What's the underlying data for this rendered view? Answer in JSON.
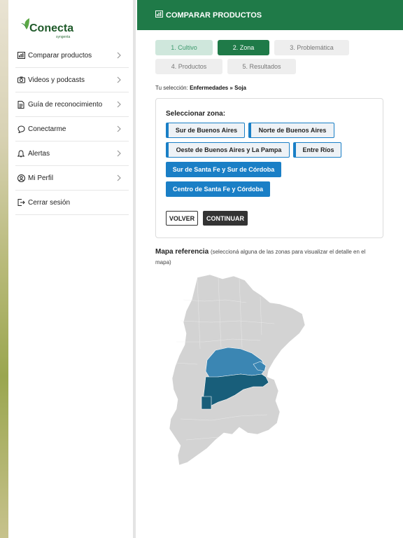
{
  "brand": {
    "name": "Conecta",
    "sub": "syngenta"
  },
  "sidebar": {
    "items": [
      {
        "label": "Comparar productos",
        "icon": "bar-chart-icon",
        "chevron": true
      },
      {
        "label": "Videos y podcasts",
        "icon": "camera-icon",
        "chevron": true
      },
      {
        "label": "Guía de reconocimiento",
        "icon": "document-icon",
        "chevron": true
      },
      {
        "label": "Conectarme",
        "icon": "chat-icon",
        "chevron": true
      },
      {
        "label": "Alertas",
        "icon": "bell-icon",
        "chevron": true
      },
      {
        "label": "Mi Perfil",
        "icon": "user-icon",
        "chevron": true
      },
      {
        "label": "Cerrar sesión",
        "icon": "logout-icon",
        "chevron": false
      }
    ]
  },
  "header": {
    "title": "COMPARAR PRODUCTOS",
    "icon": "bar-chart-icon"
  },
  "steps": [
    {
      "label": "1. Cultivo",
      "state": "done"
    },
    {
      "label": "2. Zona",
      "state": "active"
    },
    {
      "label": "3. Problemática",
      "state": "pending"
    },
    {
      "label": "4. Productos",
      "state": "pending"
    },
    {
      "label": "5. Resultados",
      "state": "pending"
    }
  ],
  "selection": {
    "prefix": "Tu selección:",
    "value": "Enfermedades » Soja"
  },
  "zone_card": {
    "title": "Seleccionar zona:",
    "zones": [
      {
        "label": "Sur de Buenos Aires",
        "selected": true
      },
      {
        "label": "Norte de Buenos Aires",
        "selected": true
      },
      {
        "label": "Oeste de Buenos Aires y La Pampa",
        "selected": true
      },
      {
        "label": "Entre Ríos",
        "selected": true
      },
      {
        "label": "Sur de Santa Fe y Sur de Córdoba",
        "selected": false
      },
      {
        "label": "Centro de Santa Fe y Córdoba",
        "selected": false
      }
    ],
    "back_label": "VOLVER",
    "continue_label": "CONTINUAR"
  },
  "map": {
    "title": "Mapa referencia",
    "note": "(seleccioná alguna de las zonas para visualizar el detalle en el mapa)",
    "colors": {
      "base": "#d3d3d3",
      "zone_light": "#3b86b3",
      "zone_dark": "#185e7a"
    }
  },
  "colors": {
    "brand_green": "#1f7a48",
    "accent_blue": "#1a7fc6",
    "step_done": "#cfe7dc"
  }
}
